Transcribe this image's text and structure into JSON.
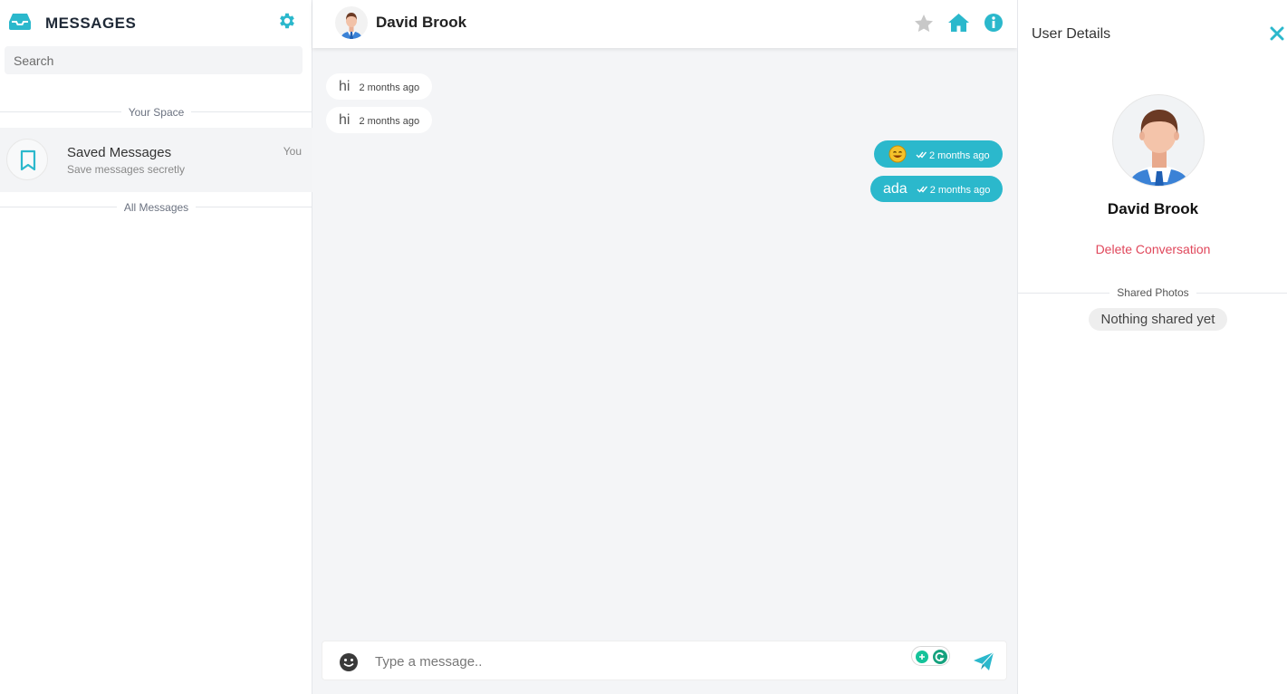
{
  "sidebar": {
    "title": "MESSAGES",
    "search_placeholder": "Search",
    "section_your_space": "Your Space",
    "saved": {
      "name": "Saved Messages",
      "subtitle": "Save messages secretly",
      "owner": "You"
    },
    "section_all": "All Messages"
  },
  "chat": {
    "contact_name": "David Brook",
    "messages": [
      {
        "direction": "in",
        "text": "hi",
        "time": "2 months ago"
      },
      {
        "direction": "in",
        "text": "hi",
        "time": "2 months ago"
      },
      {
        "direction": "out",
        "text": "",
        "emoji": "smile-emoji",
        "time": "2 months ago"
      },
      {
        "direction": "out",
        "text": "ada",
        "time": "2 months ago"
      }
    ],
    "input_placeholder": "Type a message.."
  },
  "details": {
    "title": "User Details",
    "name": "David Brook",
    "delete_label": "Delete Conversation",
    "shared_label": "Shared Photos",
    "shared_empty": "Nothing shared yet"
  },
  "colors": {
    "accent": "#2bb8cc",
    "danger": "#e0475b"
  },
  "icons": [
    "inbox-icon",
    "gear-icon",
    "bookmark-icon",
    "star-icon",
    "home-icon",
    "info-icon",
    "emoji-icon",
    "send-icon",
    "close-icon",
    "grammarly-icon"
  ]
}
